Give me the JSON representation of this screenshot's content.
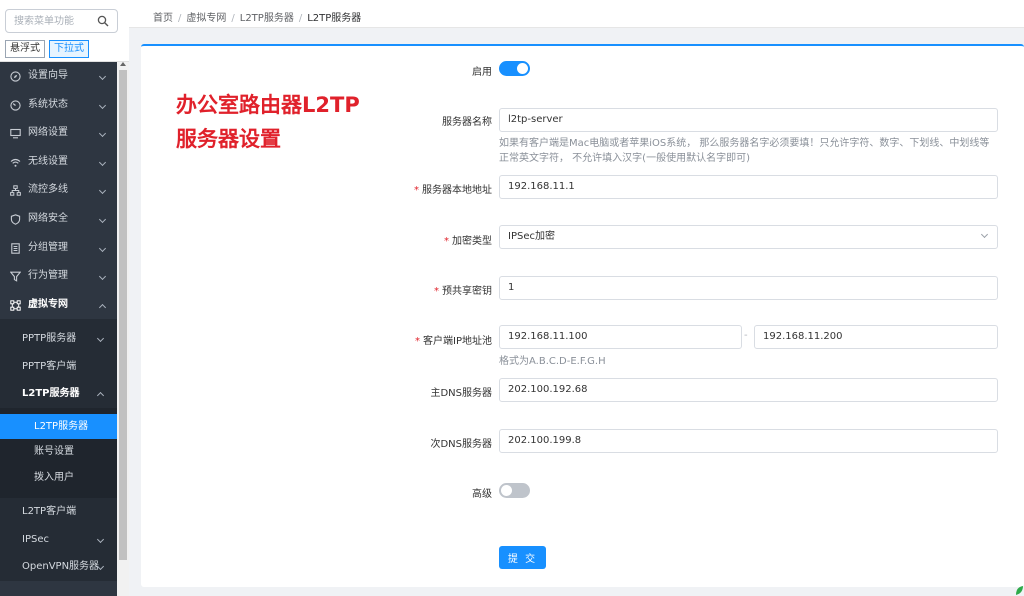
{
  "sidebar": {
    "search_placeholder": "搜索菜单功能",
    "mode_float": "悬浮式",
    "mode_dropdown": "下拉式",
    "items": [
      {
        "label": "设置向导",
        "icon": "compass-icon"
      },
      {
        "label": "系统状态",
        "icon": "gauge-icon"
      },
      {
        "label": "网络设置",
        "icon": "monitor-icon"
      },
      {
        "label": "无线设置",
        "icon": "wifi-icon"
      },
      {
        "label": "流控多线",
        "icon": "network-tree-icon"
      },
      {
        "label": "网络安全",
        "icon": "shield-icon"
      },
      {
        "label": "分组管理",
        "icon": "document-icon"
      },
      {
        "label": "行为管理",
        "icon": "filter-icon"
      },
      {
        "label": "虚拟专网",
        "icon": "vpn-icon"
      }
    ],
    "vpn_children": {
      "pptp_server": "PPTP服务器",
      "pptp_client": "PPTP客户端",
      "l2tp_server": "L2TP服务器",
      "l2tp_server_children": [
        "L2TP服务器",
        "账号设置",
        "拨入用户"
      ],
      "l2tp_client": "L2TP客户端",
      "ipsec": "IPSec",
      "openvpn": "OpenVPN服务器"
    }
  },
  "breadcrumb": [
    "首页",
    "虚拟专网",
    "L2TP服务器",
    "L2TP服务器"
  ],
  "promo": {
    "line1": "办公室路由器L2TP",
    "line2": "服务器设置"
  },
  "form": {
    "enable_label": "启用",
    "enable_on": true,
    "server_name_label": "服务器名称",
    "server_name_value": "l2tp-server",
    "server_name_help1": "如果有客户端是Mac电脑或者苹果iOS系统， 那么服务器名字必须要填！只允许字符、数字、下划线、中划线等",
    "server_name_help2": "正常英文字符， 不允许填入汉字(一般使用默认名字即可)",
    "local_addr_label": "服务器本地地址",
    "local_addr_value": "192.168.11.1",
    "encrypt_label": "加密类型",
    "encrypt_value": "IPSec加密",
    "psk_label": "预共享密钥",
    "psk_value": "1",
    "pool_label": "客户端IP地址池",
    "pool_start": "192.168.11.100",
    "pool_sep": "-",
    "pool_end": "192.168.11.200",
    "pool_help": "格式为A.B.C.D-E.F.G.H",
    "dns1_label": "主DNS服务器",
    "dns1_value": "202.100.192.68",
    "dns2_label": "次DNS服务器",
    "dns2_value": "202.100.199.8",
    "advanced_label": "高级",
    "advanced_on": false,
    "required_mark": "*",
    "submit_label": "提 交"
  }
}
